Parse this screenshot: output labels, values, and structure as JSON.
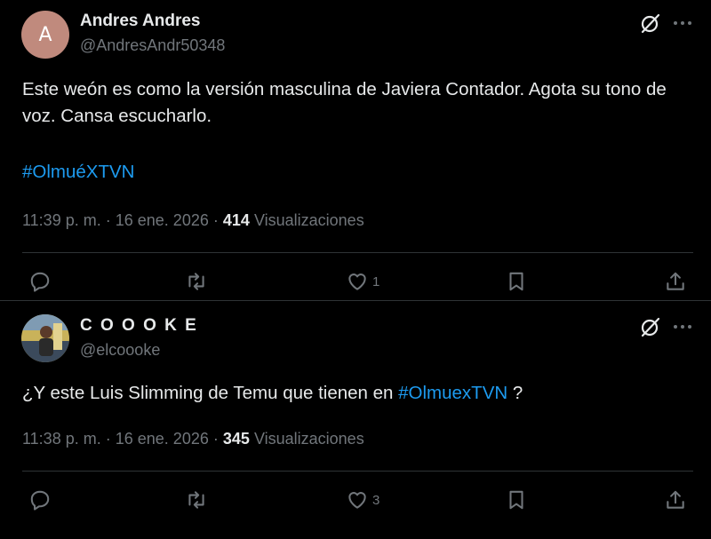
{
  "tweets": [
    {
      "avatar_letter": "A",
      "avatar_color": "#c08a7d",
      "display_name": "Andres Andres",
      "handle": "@AndresAndr50348",
      "text": "Este weón es como la versión masculina de Javiera Contador. Agota su tono de voz. Cansa escucharlo.",
      "hashtag": "#OlmuéXTVN",
      "time": "11:39 p. m.",
      "separator": "·",
      "date": "16 ene. 2026",
      "views_count": "414",
      "views_label": "Visualizaciones",
      "like_count": "1"
    },
    {
      "display_name": "C O O O K E",
      "handle": "@elcoooke",
      "text_before": "¿Y este Luis Slimming de Temu que tienen en ",
      "hashtag": "#OlmuexTVN",
      "text_after": " ?",
      "time": "11:38 p. m.",
      "separator": "·",
      "date": "16 ene. 2026",
      "views_count": "345",
      "views_label": "Visualizaciones",
      "like_count": "3"
    }
  ],
  "icons": {
    "reply": "reply-icon",
    "retweet": "retweet-icon",
    "like": "heart-icon",
    "bookmark": "bookmark-icon",
    "share": "share-icon",
    "grok": "grok-icon",
    "more": "more-icon"
  },
  "colors": {
    "background": "#000000",
    "text": "#e7e9ea",
    "secondary": "#71767b",
    "link": "#1d9bf0",
    "divider": "#2f3336"
  }
}
